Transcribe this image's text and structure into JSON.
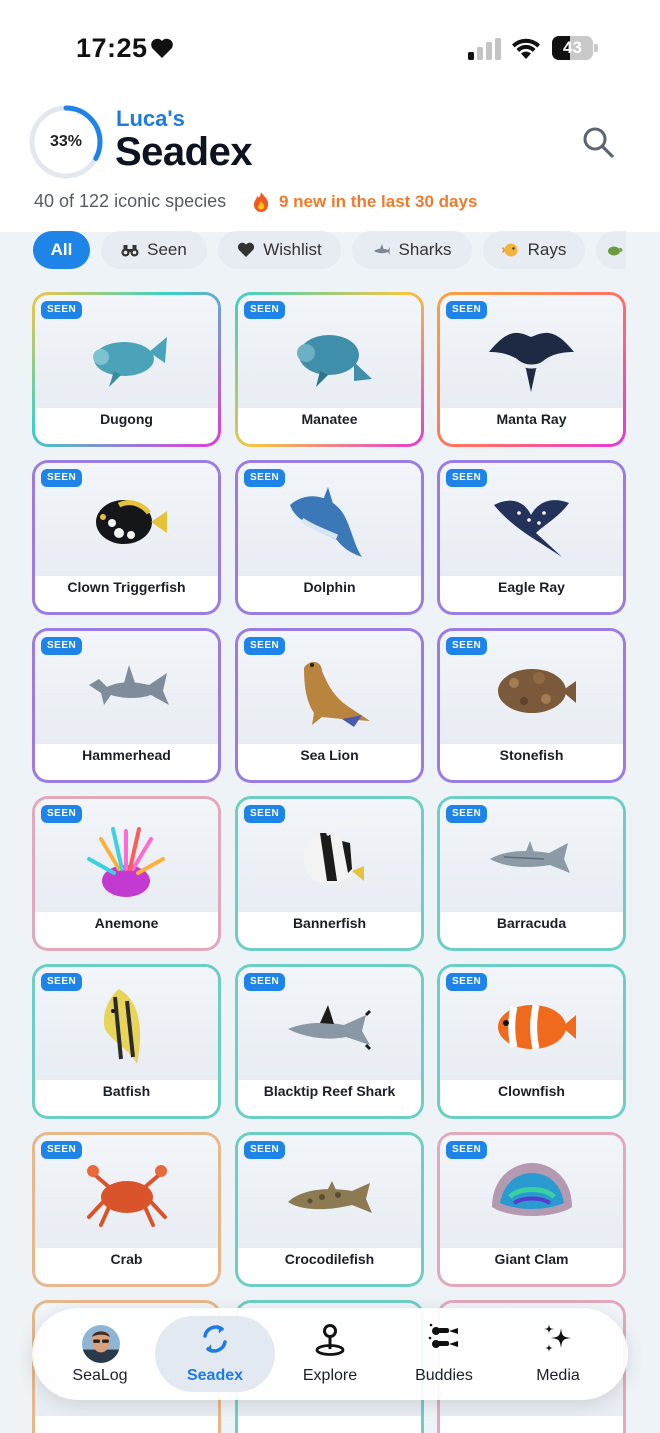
{
  "status_bar": {
    "time": "17:25",
    "battery": "43",
    "battery_level": 0.43
  },
  "header": {
    "progress_text": "33%",
    "progress": 0.33,
    "owner": "Luca's",
    "title": "Seadex",
    "species_count": "40 of 122 iconic species",
    "new_text": "9 new in the last 30 days"
  },
  "filters": [
    "All",
    "Seen",
    "Wishlist",
    "Sharks",
    "Rays"
  ],
  "cards": [
    {
      "name": "Dugong",
      "badge": "SEEN"
    },
    {
      "name": "Manatee",
      "badge": "SEEN"
    },
    {
      "name": "Manta Ray",
      "badge": "SEEN"
    },
    {
      "name": "Clown Triggerfish",
      "badge": "SEEN"
    },
    {
      "name": "Dolphin",
      "badge": "SEEN"
    },
    {
      "name": "Eagle Ray",
      "badge": "SEEN"
    },
    {
      "name": "Hammerhead",
      "badge": "SEEN"
    },
    {
      "name": "Sea Lion",
      "badge": "SEEN"
    },
    {
      "name": "Stonefish",
      "badge": "SEEN"
    },
    {
      "name": "Anemone",
      "badge": "SEEN"
    },
    {
      "name": "Bannerfish",
      "badge": "SEEN"
    },
    {
      "name": "Barracuda",
      "badge": "SEEN"
    },
    {
      "name": "Batfish",
      "badge": "SEEN"
    },
    {
      "name": "Blacktip Reef Shark",
      "badge": "SEEN"
    },
    {
      "name": "Clownfish",
      "badge": "SEEN"
    },
    {
      "name": "Crab",
      "badge": "SEEN"
    },
    {
      "name": "Crocodilefish",
      "badge": "SEEN"
    },
    {
      "name": "Giant Clam",
      "badge": "SEEN"
    }
  ],
  "tabs": [
    "SeaLog",
    "Seadex",
    "Explore",
    "Buddies",
    "Media"
  ],
  "colors": {
    "accent": "#1e84e8",
    "new_orange": "#f07a2b",
    "badge": "#1e84e8"
  }
}
